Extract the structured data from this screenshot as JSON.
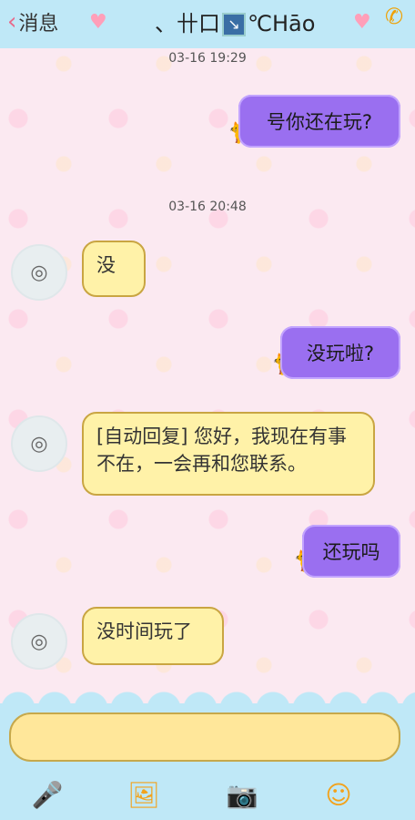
{
  "header": {
    "back_label": "消息",
    "title_left": "、卄口",
    "title_box": "↘",
    "title_right": "℃Hāo"
  },
  "messages": [
    {
      "type": "time",
      "text": "03-16 19:29"
    },
    {
      "type": "sent",
      "text": "号你还在玩?"
    },
    {
      "type": "time",
      "text": "03-16 20:48"
    },
    {
      "type": "received",
      "text": "没"
    },
    {
      "type": "sent",
      "text": "没玩啦?"
    },
    {
      "type": "received",
      "text": "[自动回复] 您好，我现在有事不在，一会再和您联系。"
    },
    {
      "type": "sent",
      "text": "还玩吗"
    },
    {
      "type": "received",
      "text": "没时间玩了"
    }
  ],
  "toolbar": {
    "icons": [
      "microphone-icon",
      "photo-icon",
      "camera-icon",
      "emoji-icon"
    ]
  }
}
